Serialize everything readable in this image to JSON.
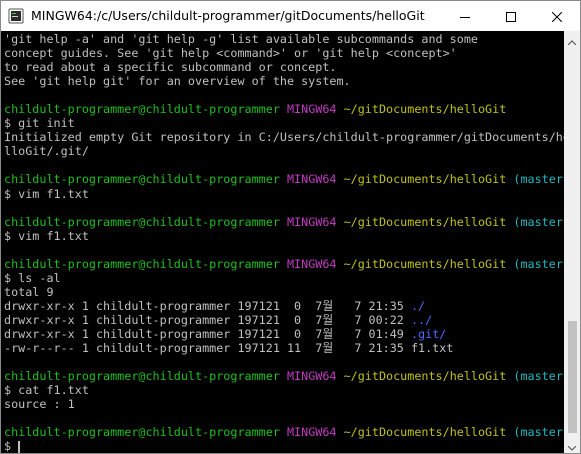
{
  "window": {
    "title": "MINGW64:/c/Users/childult-programmer/gitDocuments/helloGit",
    "minimize_icon": "minimize-icon",
    "maximize_icon": "maximize-icon",
    "close_icon": "close-icon"
  },
  "colors": {
    "user": "#1cc01c",
    "shell": "#c13cc1",
    "path": "#c0c01c",
    "branch": "#1cb8c0",
    "dir": "#4b6bff",
    "text": "#c0c0c0",
    "background": "#000000"
  },
  "terminal": {
    "lines": [
      [
        {
          "t": "'git help -a' and 'git help -g' list available subcommands and some",
          "c": "white"
        }
      ],
      [
        {
          "t": "concept guides. See 'git help <command>' or 'git help <concept>'",
          "c": "white"
        }
      ],
      [
        {
          "t": "to read about a specific subcommand or concept.",
          "c": "white"
        }
      ],
      [
        {
          "t": "See 'git help git' for an overview of the system.",
          "c": "white"
        }
      ],
      [],
      [
        {
          "t": "childult-programmer@childult-programmer",
          "c": "green"
        },
        {
          "t": " ",
          "c": "white"
        },
        {
          "t": "MINGW64",
          "c": "mag"
        },
        {
          "t": " ",
          "c": "white"
        },
        {
          "t": "~/gitDocuments/helloGit",
          "c": "yel"
        }
      ],
      [
        {
          "t": "$ git init",
          "c": "white"
        }
      ],
      [
        {
          "t": "Initialized empty Git repository in C:/Users/childult-programmer/gitDocuments/he",
          "c": "white"
        }
      ],
      [
        {
          "t": "lloGit/.git/",
          "c": "white"
        }
      ],
      [],
      [
        {
          "t": "childult-programmer@childult-programmer",
          "c": "green"
        },
        {
          "t": " ",
          "c": "white"
        },
        {
          "t": "MINGW64",
          "c": "mag"
        },
        {
          "t": " ",
          "c": "white"
        },
        {
          "t": "~/gitDocuments/helloGit",
          "c": "yel"
        },
        {
          "t": " ",
          "c": "white"
        },
        {
          "t": "(master)",
          "c": "cyan"
        }
      ],
      [
        {
          "t": "$ vim f1.txt",
          "c": "white"
        }
      ],
      [],
      [
        {
          "t": "childult-programmer@childult-programmer",
          "c": "green"
        },
        {
          "t": " ",
          "c": "white"
        },
        {
          "t": "MINGW64",
          "c": "mag"
        },
        {
          "t": " ",
          "c": "white"
        },
        {
          "t": "~/gitDocuments/helloGit",
          "c": "yel"
        },
        {
          "t": " ",
          "c": "white"
        },
        {
          "t": "(master)",
          "c": "cyan"
        }
      ],
      [
        {
          "t": "$ vim f1.txt",
          "c": "white"
        }
      ],
      [],
      [
        {
          "t": "childult-programmer@childult-programmer",
          "c": "green"
        },
        {
          "t": " ",
          "c": "white"
        },
        {
          "t": "MINGW64",
          "c": "mag"
        },
        {
          "t": " ",
          "c": "white"
        },
        {
          "t": "~/gitDocuments/helloGit",
          "c": "yel"
        },
        {
          "t": " ",
          "c": "white"
        },
        {
          "t": "(master)",
          "c": "cyan"
        }
      ],
      [
        {
          "t": "$ ls -al",
          "c": "white"
        }
      ],
      [
        {
          "t": "total 9",
          "c": "white"
        }
      ],
      [
        {
          "t": "drwxr-xr-x 1 childult-programmer 197121  0  7월   7 21:35 ",
          "c": "white"
        },
        {
          "t": "./",
          "c": "blue"
        }
      ],
      [
        {
          "t": "drwxr-xr-x 1 childult-programmer 197121  0  7월   7 00:22 ",
          "c": "white"
        },
        {
          "t": "../",
          "c": "blue"
        }
      ],
      [
        {
          "t": "drwxr-xr-x 1 childult-programmer 197121  0  7월   7 01:49 ",
          "c": "white"
        },
        {
          "t": ".git/",
          "c": "blue"
        }
      ],
      [
        {
          "t": "-rw-r--r-- 1 childult-programmer 197121 11  7월   7 21:35 f1.txt",
          "c": "white"
        }
      ],
      [],
      [
        {
          "t": "childult-programmer@childult-programmer",
          "c": "green"
        },
        {
          "t": " ",
          "c": "white"
        },
        {
          "t": "MINGW64",
          "c": "mag"
        },
        {
          "t": " ",
          "c": "white"
        },
        {
          "t": "~/gitDocuments/helloGit",
          "c": "yel"
        },
        {
          "t": " ",
          "c": "white"
        },
        {
          "t": "(master)",
          "c": "cyan"
        }
      ],
      [
        {
          "t": "$ cat f1.txt",
          "c": "white"
        }
      ],
      [
        {
          "t": "source : 1",
          "c": "white"
        }
      ],
      [],
      [
        {
          "t": "childult-programmer@childult-programmer",
          "c": "green"
        },
        {
          "t": " ",
          "c": "white"
        },
        {
          "t": "MINGW64",
          "c": "mag"
        },
        {
          "t": " ",
          "c": "white"
        },
        {
          "t": "~/gitDocuments/helloGit",
          "c": "yel"
        },
        {
          "t": " ",
          "c": "white"
        },
        {
          "t": "(master)",
          "c": "cyan"
        }
      ],
      [
        {
          "t": "$ ",
          "c": "white"
        }
      ]
    ]
  },
  "scrollbar": {
    "up_icon": "scroll-up-icon",
    "down_icon": "scroll-down-icon"
  }
}
